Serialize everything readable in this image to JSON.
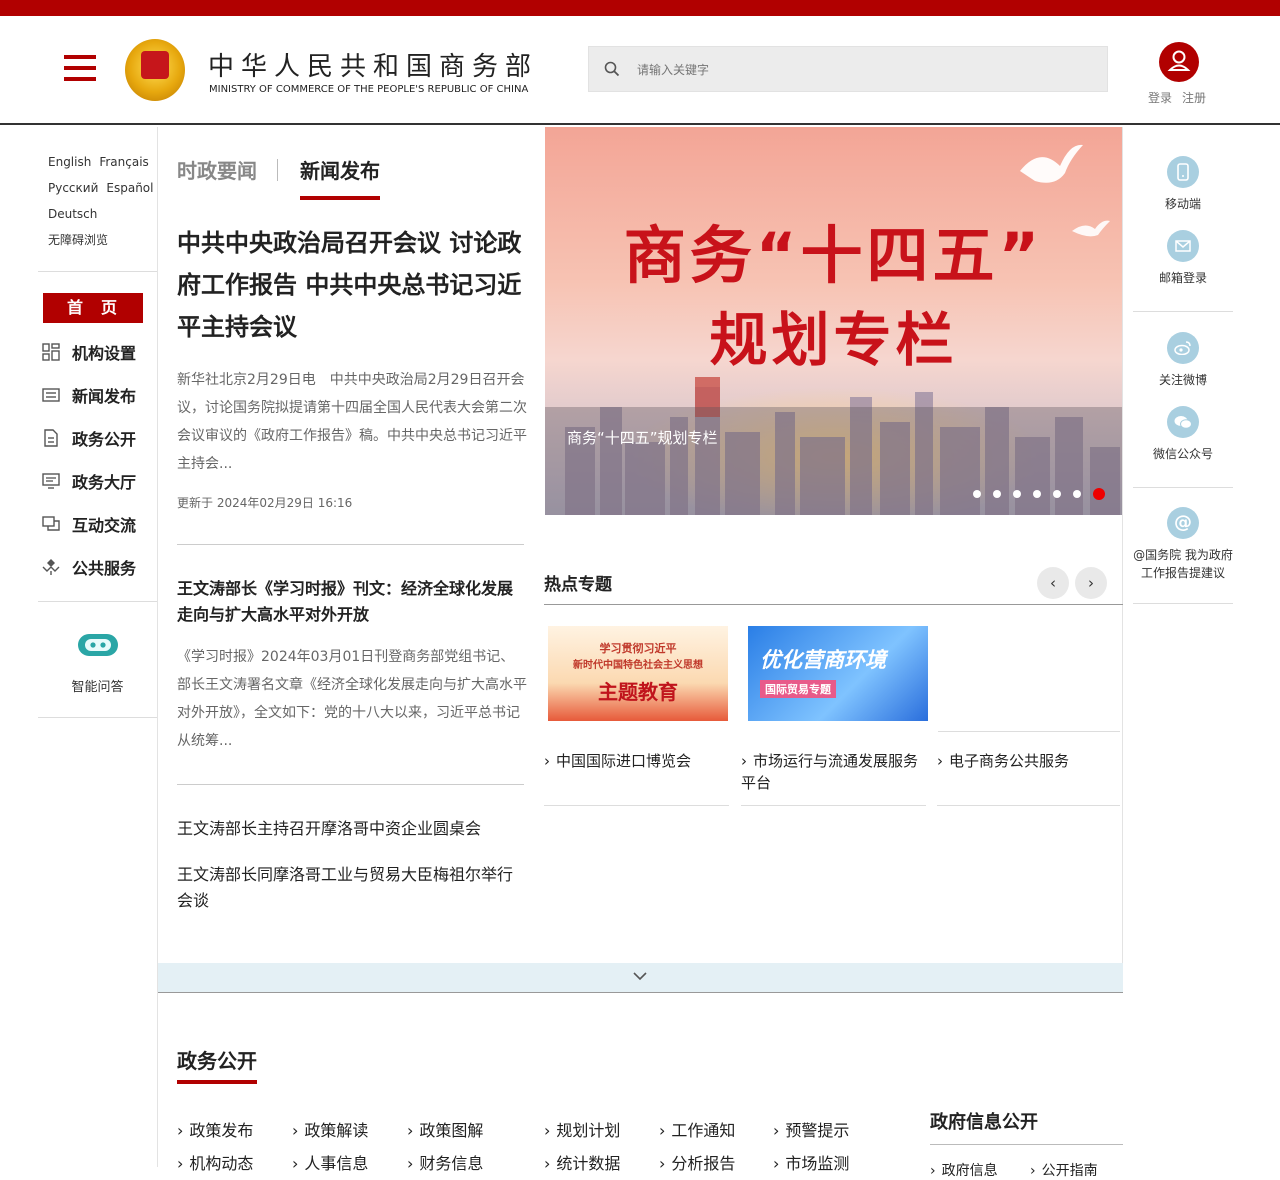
{
  "header": {
    "title_cn": "中华人民共和国商务部",
    "title_en": "MINISTRY OF COMMERCE OF THE PEOPLE'S REPUBLIC OF CHINA",
    "search_placeholder": "请输入关键字",
    "login": "登录",
    "register": "注册",
    "brand_color": "#b10000"
  },
  "languages": [
    "English",
    "Français",
    "Русский",
    "Español",
    "Deutsch",
    "无障碍浏览"
  ],
  "sidebar": {
    "home": "首页",
    "items": [
      {
        "label": "机构设置",
        "icon": "grid-icon"
      },
      {
        "label": "新闻发布",
        "icon": "newspaper-icon"
      },
      {
        "label": "政务公开",
        "icon": "document-icon"
      },
      {
        "label": "政务大厅",
        "icon": "list-icon"
      },
      {
        "label": "互动交流",
        "icon": "chat-icon"
      },
      {
        "label": "公共服务",
        "icon": "service-icon"
      }
    ],
    "assistant": "智能问答"
  },
  "news": {
    "tabs": [
      "时政要闻",
      "新闻发布"
    ],
    "active_tab": "新闻发布",
    "headline": "中共中央政治局召开会议 讨论政府工作报告 中共中央总书记习近平主持会议",
    "summary": "新华社北京2月29日电　中共中央政治局2月29日召开会议，讨论国务院拟提请第十四届全国人民代表大会第二次会议审议的《政府工作报告》稿。中共中央总书记习近平主持会...",
    "updated": "更新于 2024年02月29日 16:16",
    "item2_title": "王文涛部长《学习时报》刊文：经济全球化发展走向与扩大高水平对外开放",
    "item2_summary": "《学习时报》2024年03月01日刊登商务部党组书记、部长王文涛署名文章《经济全球化发展走向与扩大高水平对外开放》，全文如下：党的十八大以来，习近平总书记从统筹...",
    "links": [
      "王文涛部长主持召开摩洛哥中资企业圆桌会",
      "王文涛部长同摩洛哥工业与贸易大臣梅祖尔举行会谈"
    ]
  },
  "banner": {
    "line1": "商务“十四五”",
    "line2": "规划专栏",
    "caption": "商务“十四五”规划专栏",
    "slide_count": 7,
    "active_slide": 7
  },
  "hot": {
    "title": "热点专题",
    "img1_line1": "学习贯彻习近平",
    "img1_line2": "新时代中国特色社会主义思想",
    "img1_line3": "主题教育",
    "img2_line1": "优化营商环境",
    "img2_line2": "国际贸易专题",
    "links": [
      "中国国际进口博览会",
      "市场运行与流通发展服务平台",
      "电子商务公共服务"
    ]
  },
  "right": {
    "items": [
      {
        "label": "移动端",
        "icon": "mobile-icon"
      },
      {
        "label": "邮箱登录",
        "icon": "mail-icon"
      },
      {
        "label": "关注微博",
        "icon": "weibo-icon"
      },
      {
        "label": "微信公众号",
        "icon": "wechat-icon"
      },
      {
        "label": "@国务院 我为政府工作报告提建议",
        "icon": "at-icon"
      }
    ]
  },
  "section": {
    "title": "政务公开",
    "row1": [
      "政策发布",
      "政策解读",
      "政策图解",
      "规划计划",
      "工作通知",
      "预警提示"
    ],
    "row2": [
      "机构动态",
      "人事信息",
      "财务信息",
      "统计数据",
      "分析报告",
      "市场监测"
    ],
    "gov_title": "政府信息公开",
    "gov_partial": [
      "政府信息",
      "公开指南"
    ]
  }
}
